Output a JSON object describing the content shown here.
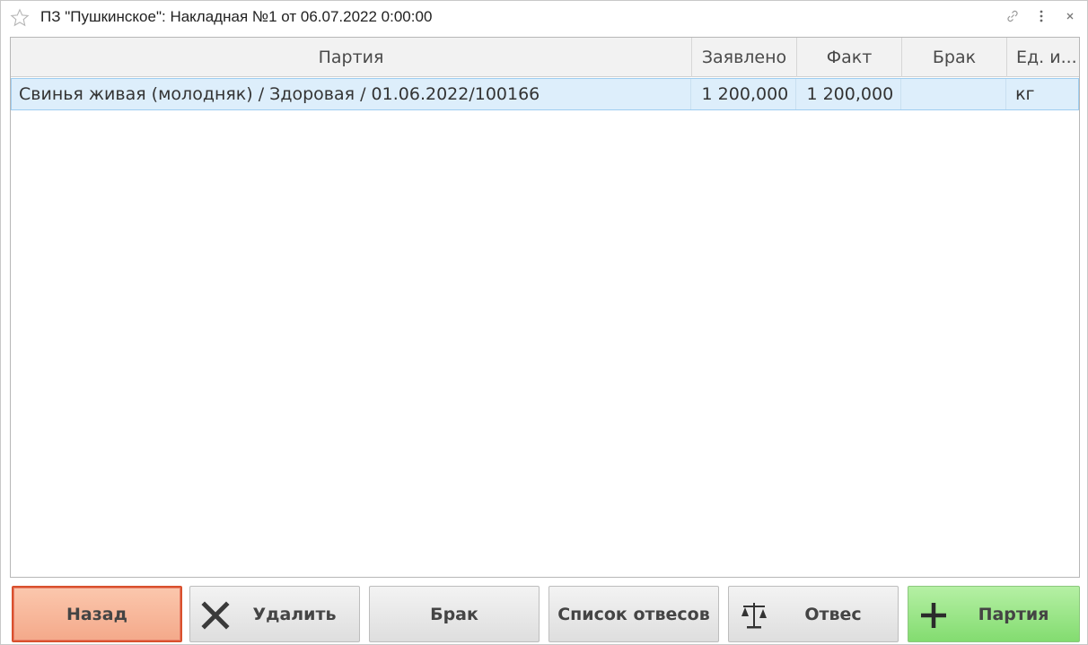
{
  "window": {
    "title": "ПЗ \"Пушкинское\": Накладная №1 от 06.07.2022 0:00:00",
    "icons": [
      "star-icon",
      "link-icon",
      "more-icon",
      "close-icon"
    ]
  },
  "grid": {
    "columns": [
      "Партия",
      "Заявлено",
      "Факт",
      "Брак",
      "Ед. и..."
    ],
    "rows": [
      {
        "party": "Свинья живая (молодняк) / Здоровая / 01.06.2022/100166",
        "declared": "1 200,000",
        "fact": "1 200,000",
        "defect": "",
        "unit": "кг"
      }
    ],
    "selected_row_color": "#ddeefb"
  },
  "buttons": {
    "back": "Назад",
    "delete": "Удалить",
    "defect": "Брак",
    "weighing_list": "Список отвесов",
    "weighing": "Отвес",
    "add_party": "Партия"
  },
  "colors": {
    "back_button": "#f4a98a",
    "back_border": "#d9502d",
    "add_button": "#83dc70"
  }
}
